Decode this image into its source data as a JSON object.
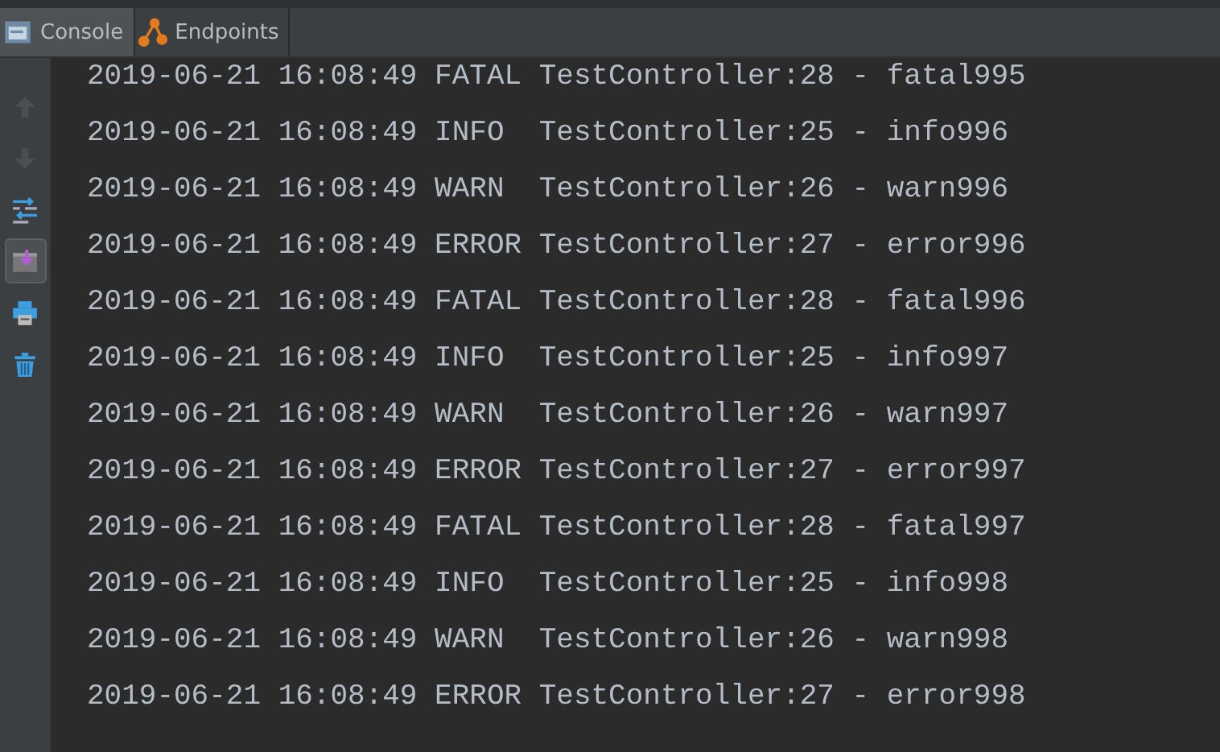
{
  "tabs": [
    {
      "label": "Console",
      "selected": true
    },
    {
      "label": "Endpoints",
      "selected": false
    }
  ],
  "toolbar": [
    {
      "disabled": true,
      "selected": false
    },
    {
      "disabled": true,
      "selected": false
    },
    {
      "disabled": false,
      "selected": false
    },
    {
      "disabled": false,
      "selected": true
    },
    {
      "disabled": false,
      "selected": false
    },
    {
      "disabled": false,
      "selected": false
    }
  ],
  "console_lines": [
    "2019-06-21 16:08:49 FATAL TestController:28 - fatal995",
    "2019-06-21 16:08:49 INFO  TestController:25 - info996",
    "2019-06-21 16:08:49 WARN  TestController:26 - warn996",
    "2019-06-21 16:08:49 ERROR TestController:27 - error996",
    "2019-06-21 16:08:49 FATAL TestController:28 - fatal996",
    "2019-06-21 16:08:49 INFO  TestController:25 - info997",
    "2019-06-21 16:08:49 WARN  TestController:26 - warn997",
    "2019-06-21 16:08:49 ERROR TestController:27 - error997",
    "2019-06-21 16:08:49 FATAL TestController:28 - fatal997",
    "2019-06-21 16:08:49 INFO  TestController:25 - info998",
    "2019-06-21 16:08:49 WARN  TestController:26 - warn998",
    "2019-06-21 16:08:49 ERROR TestController:27 - error998"
  ]
}
